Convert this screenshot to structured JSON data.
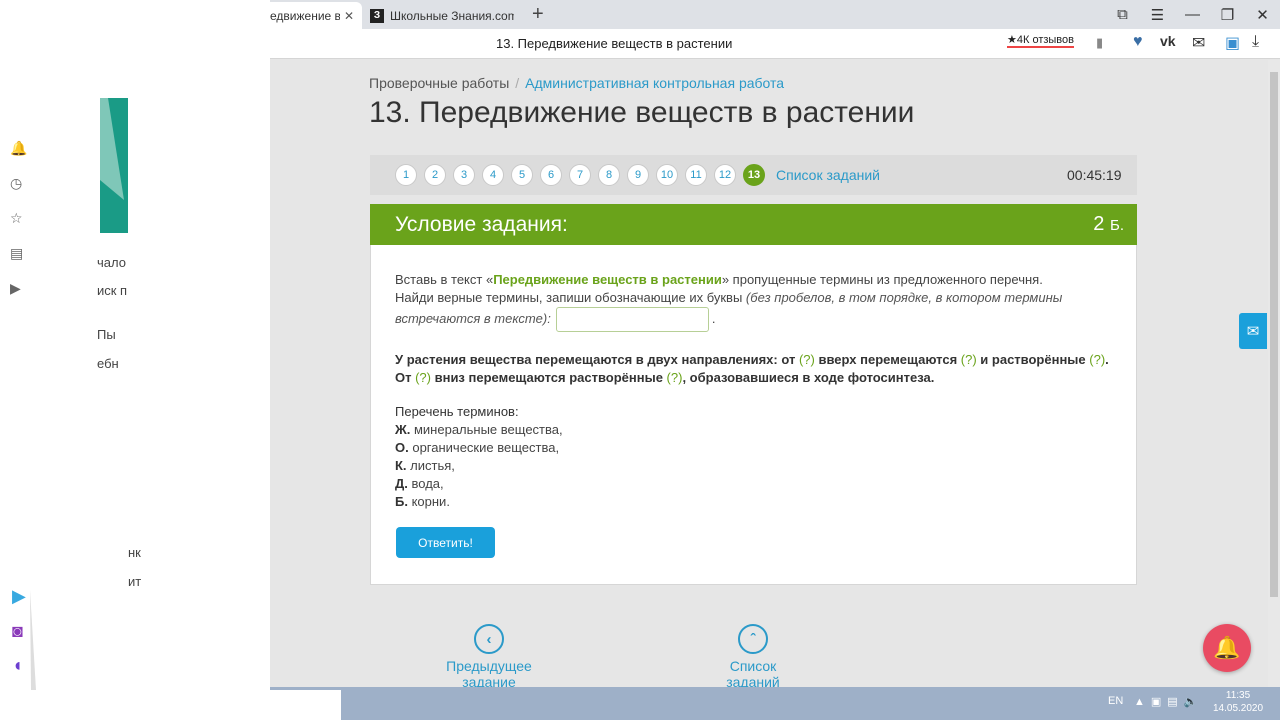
{
  "browser": {
    "active_tab_title": "едвижение вещ",
    "inactive_tab_title": "Школьные Знания.com - Р",
    "inactive_tab_icon": "З",
    "new_tab": "+",
    "address_title": "13. Передвижение веществ в растении",
    "reviews": "★4К отзывов"
  },
  "breadcrumb": {
    "item1": "Проверочные работы",
    "separator": "/",
    "item2": "Административная контрольная работа"
  },
  "page_title": "13. Передвижение веществ в растении",
  "task_nav": {
    "numbers": [
      "1",
      "2",
      "3",
      "4",
      "5",
      "6",
      "7",
      "8",
      "9",
      "10",
      "11",
      "12",
      "13"
    ],
    "active": "13",
    "task_list_link": "Список заданий",
    "timer": "00:45:19"
  },
  "condition": {
    "title": "Условие задания:",
    "points": "2",
    "points_unit": "Б."
  },
  "instruction": {
    "p1_start": "Вставь в текст «",
    "p1_bold": "Передвижение веществ в растении",
    "p1_end": "» пропущенные термины из предложенного перечня.",
    "p2": "Найди верные термины, запиши обозначающие их буквы ",
    "p2_italic": "(без пробелов, в том порядке, в котором термины встречаются в тексте):",
    "answer_value": "",
    "dot": "."
  },
  "task_text": {
    "s1": "У растения вещества перемещаются в двух направлениях: от ",
    "q": "(?)",
    "s2": " вверх перемещаются ",
    "s3": " и растворённые ",
    "s4": ".",
    "s5": "От ",
    "s6": " вниз перемещаются растворённые ",
    "s7": ", образовавшиеся в ходе фотосинтеза."
  },
  "terms": {
    "header": "Перечень терминов:",
    "items": [
      {
        "letter": "Ж.",
        "text": " минеральные вещества,"
      },
      {
        "letter": "О.",
        "text": " органические вещества,"
      },
      {
        "letter": "К.",
        "text": " листья,"
      },
      {
        "letter": "Д.",
        "text": " вода,"
      },
      {
        "letter": "Б.",
        "text": " корни."
      }
    ]
  },
  "submit_label": "Ответить!",
  "nav": {
    "prev_label": "Предыдущее задание",
    "list_label": "Список заданий"
  },
  "taskbar": {
    "lang": "EN",
    "time": "11:35",
    "date": "14.05.2020"
  },
  "overlay": {
    "texts": [
      "чало",
      "иск п",
      "Пы",
      "ебн",
      "нк",
      "ит"
    ]
  },
  "colors": {
    "accent_green": "#6aa31b",
    "link_blue": "#2b9ac9",
    "button_blue": "#1aa0db",
    "bell_red": "#e94b62"
  }
}
